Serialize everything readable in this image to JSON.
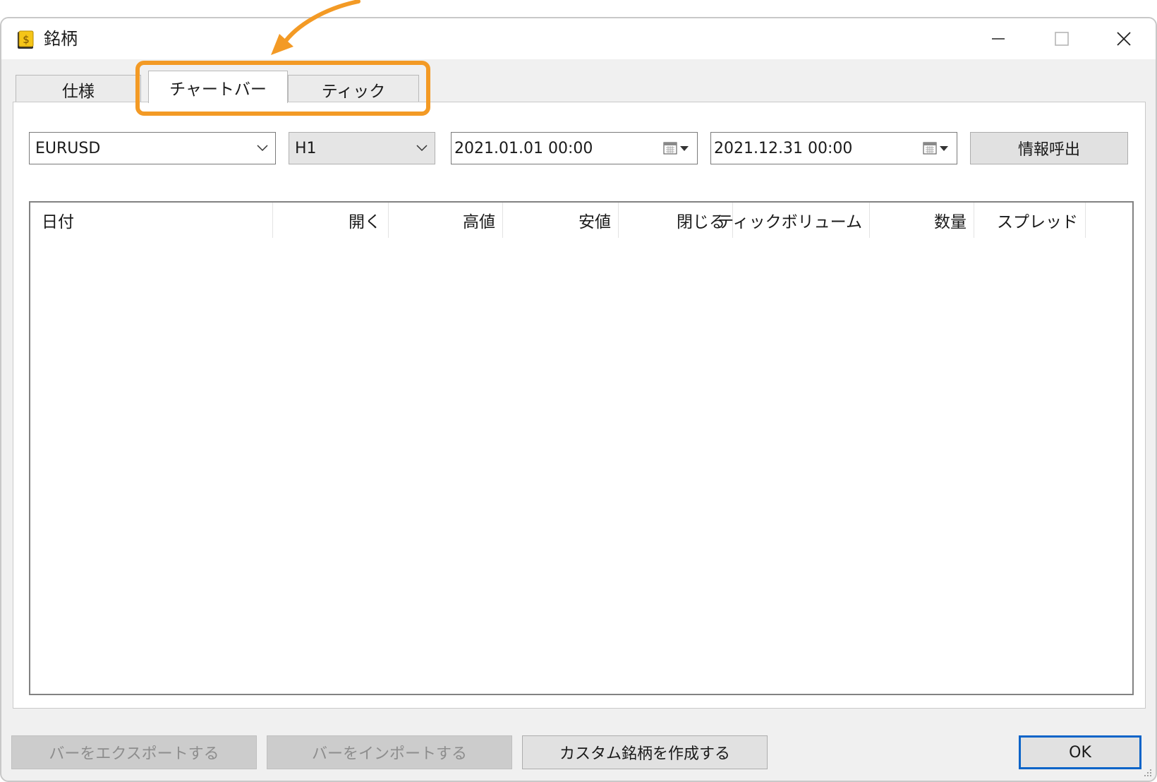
{
  "window": {
    "title": "銘柄",
    "controls": [
      "minimize-icon",
      "maximize-icon",
      "close-icon"
    ]
  },
  "tabs": [
    {
      "label": "仕様",
      "active": false
    },
    {
      "label": "チャートバー",
      "active": true
    },
    {
      "label": "ティック",
      "active": false
    }
  ],
  "toolbar": {
    "symbol": "EURUSD",
    "timeframe": "H1",
    "date_from": "2021.01.01 00:00",
    "date_to": "2021.12.31 00:00",
    "request_label": "情報呼出"
  },
  "table": {
    "columns": [
      "日付",
      "開く",
      "高値",
      "安値",
      "閉じる",
      "ティックボリューム",
      "数量",
      "スプレッド"
    ],
    "rows": []
  },
  "footer": {
    "export_label": "バーをエクスポートする",
    "import_label": "バーをインポートする",
    "custom_label": "カスタム銘柄を作成する",
    "ok_label": "OK"
  },
  "colors": {
    "highlight": "#f39a25",
    "ok_border": "#0a64c8",
    "icon_gold": "#f5c518"
  }
}
